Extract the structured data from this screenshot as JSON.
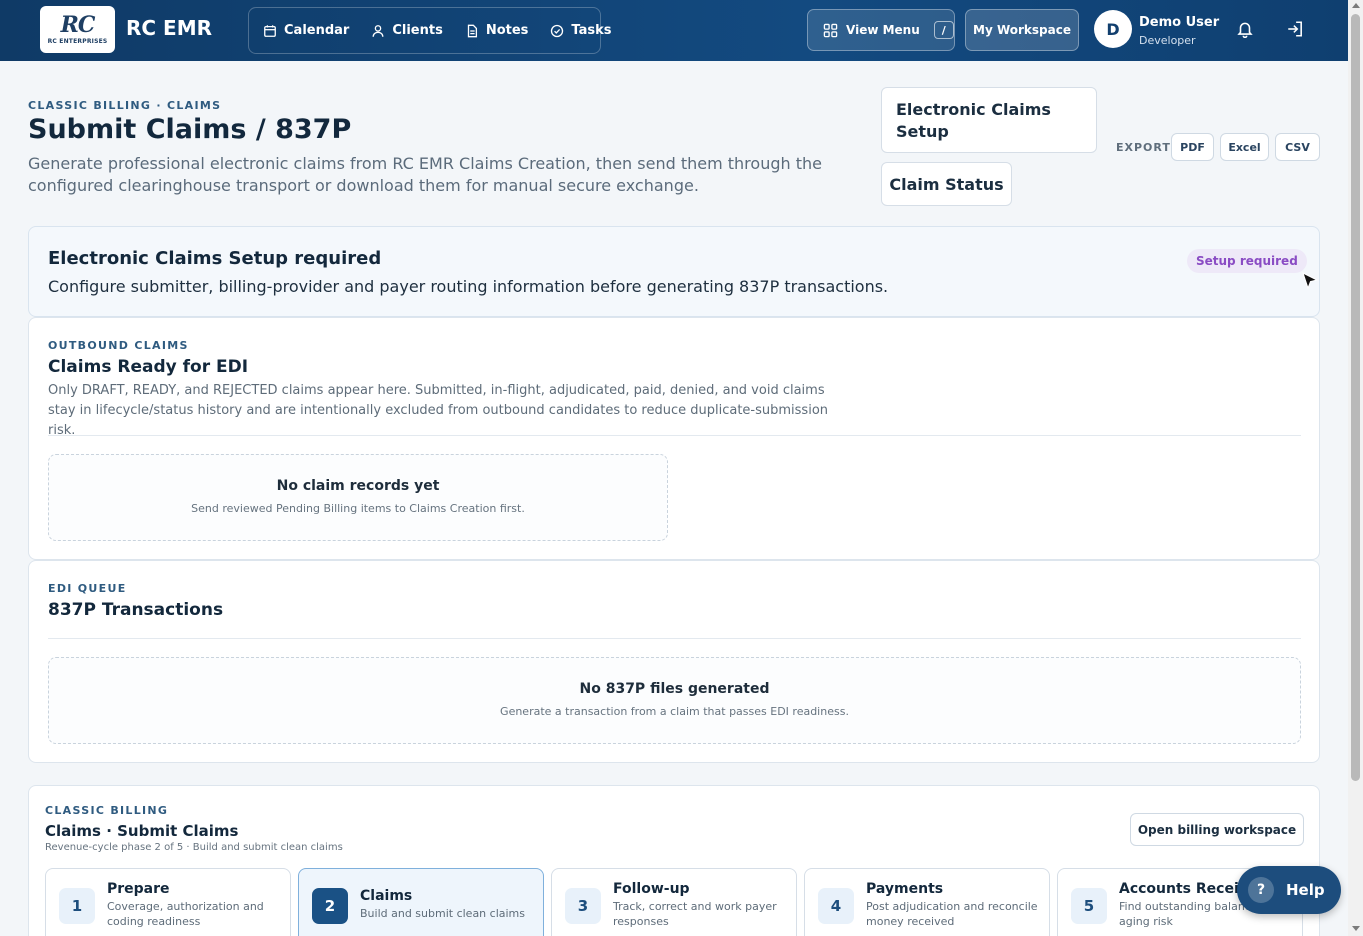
{
  "header": {
    "logo_text": "RC",
    "logo_sub": "RC ENTERPRISES",
    "app_title": "RC EMR",
    "nav": [
      {
        "label": "Calendar",
        "icon": "calendar-icon"
      },
      {
        "label": "Clients",
        "icon": "user-icon"
      },
      {
        "label": "Notes",
        "icon": "document-icon"
      },
      {
        "label": "Tasks",
        "icon": "check-circle-icon"
      }
    ],
    "view_menu_label": "View Menu",
    "view_menu_shortcut": "/",
    "workspace_label": "My Workspace",
    "avatar_initial": "D",
    "user_name": "Demo User",
    "user_role": "Developer"
  },
  "page": {
    "eyebrow": "CLASSIC BILLING · CLAIMS",
    "title": "Submit Claims / 837P",
    "subtitle": "Generate professional electronic claims from RC EMR Claims Creation, then send them through the configured clearinghouse transport or download them for manual secure exchange.",
    "setup_button": "Electronic Claims Setup",
    "status_button": "Claim Status",
    "export_label": "EXPORT",
    "export_options": [
      "PDF",
      "Excel",
      "CSV"
    ]
  },
  "alert": {
    "title": "Electronic Claims Setup required",
    "text": "Configure submitter, billing-provider and payer routing information before generating 837P transactions.",
    "badge": "Setup required"
  },
  "outbound": {
    "eyebrow": "OUTBOUND CLAIMS",
    "title": "Claims Ready for EDI",
    "description": "Only DRAFT, READY, and REJECTED claims appear here. Submitted, in-flight, adjudicated, paid, denied, and void claims stay in lifecycle/status history and are intentionally excluded from outbound candidates to reduce duplicate-submission risk.",
    "empty_title": "No claim records yet",
    "empty_sub": "Send reviewed Pending Billing items to Claims Creation first."
  },
  "edi": {
    "eyebrow": "EDI QUEUE",
    "title": "837P Transactions",
    "empty_title": "No 837P files generated",
    "empty_sub": "Generate a transaction from a claim that passes EDI readiness."
  },
  "billing": {
    "eyebrow": "CLASSIC BILLING",
    "title": "Claims · Submit Claims",
    "subtitle": "Revenue-cycle phase 2 of 5 · Build and submit clean claims",
    "open_button": "Open billing workspace",
    "phases": [
      {
        "num": "1",
        "title": "Prepare",
        "desc": "Coverage, authorization and coding readiness"
      },
      {
        "num": "2",
        "title": "Claims",
        "desc": "Build and submit clean claims"
      },
      {
        "num": "3",
        "title": "Follow-up",
        "desc": "Track, correct and work payer responses"
      },
      {
        "num": "4",
        "title": "Payments",
        "desc": "Post adjudication and reconcile money received"
      },
      {
        "num": "5",
        "title": "Accounts Receivable",
        "desc": "Find outstanding balances and aging risk"
      }
    ]
  },
  "help_label": "Help",
  "help_glyph": "?",
  "colors": {
    "header": "#134a80",
    "accent": "#1a5185",
    "badge": "#8a4cc4"
  }
}
